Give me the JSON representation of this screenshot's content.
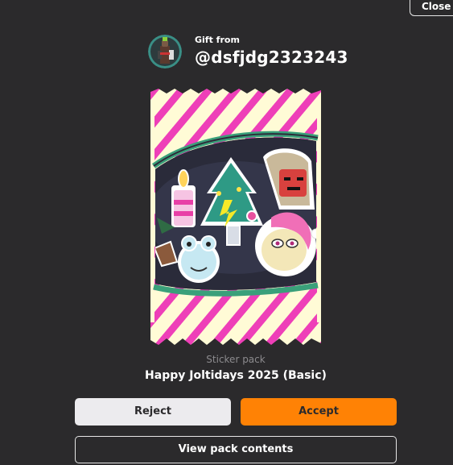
{
  "dialog": {
    "close_label": "Close",
    "gift_label": "Gift from",
    "sender_username": "@dsfjdg2323243"
  },
  "pack": {
    "type_label": "Sticker pack",
    "name": "Happy Joltidays 2025 (Basic)",
    "stickers": [
      "candle-sticker",
      "christmas-tree-sticker",
      "sack-character-sticker",
      "santa-moon-sticker",
      "snow-frog-sticker"
    ]
  },
  "actions": {
    "reject_label": "Reject",
    "accept_label": "Accept",
    "view_contents_label": "View pack contents"
  },
  "colors": {
    "background": "#2b2a2c",
    "accent": "#ff8205",
    "reject_bg": "#ecebee",
    "pack_stripe": "#ee3fb8",
    "pack_cream": "#fffbd6"
  }
}
